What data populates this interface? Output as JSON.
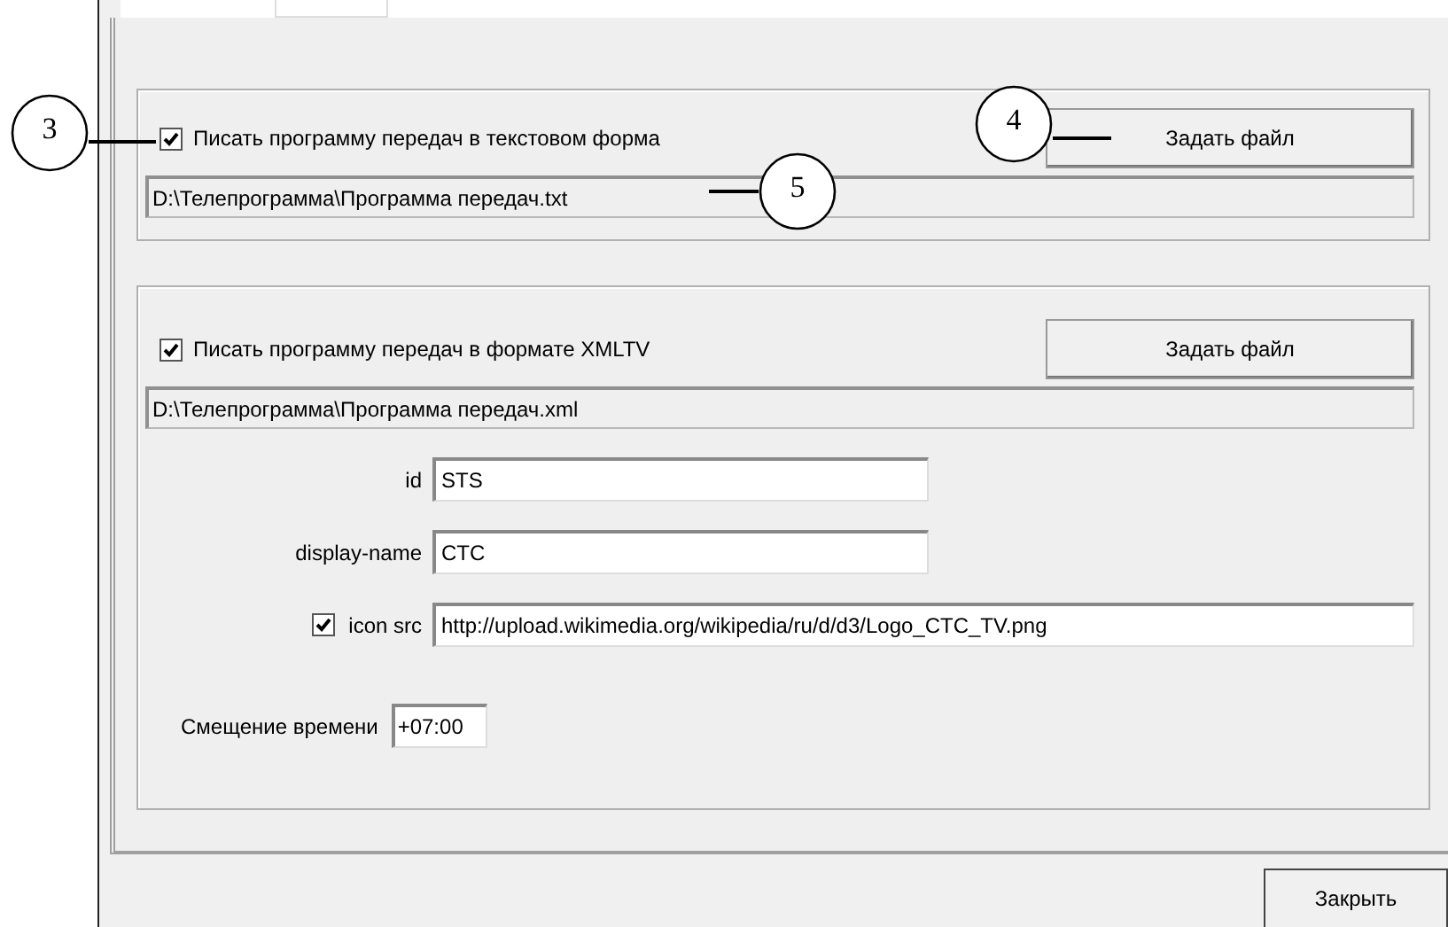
{
  "text_output": {
    "enabled": true,
    "label": "Писать программу передач в текстовом форма",
    "button": "Задать файл",
    "path": "D:\\Телепрограмма\\Программа передач.txt"
  },
  "xmltv_output": {
    "enabled": true,
    "label": "Писать программу передач в формате XMLTV",
    "button": "Задать файл",
    "path": "D:\\Телепрограмма\\Программа передач.xml",
    "fields": [
      {
        "kind": "text",
        "label": "id",
        "value": "STS"
      },
      {
        "kind": "text",
        "label": "display-name",
        "value": "CTC"
      },
      {
        "kind": "check",
        "label": "icon src",
        "checked": true,
        "value": "http://upload.wikimedia.org/wikipedia/ru/d/d3/Logo_CTC_TV.png"
      }
    ],
    "offset": {
      "label": "Смещение времени",
      "value": "+07:00"
    }
  },
  "callouts": [
    {
      "number": "3"
    },
    {
      "number": "4"
    },
    {
      "number": "5"
    }
  ],
  "close_button": "Закрыть"
}
